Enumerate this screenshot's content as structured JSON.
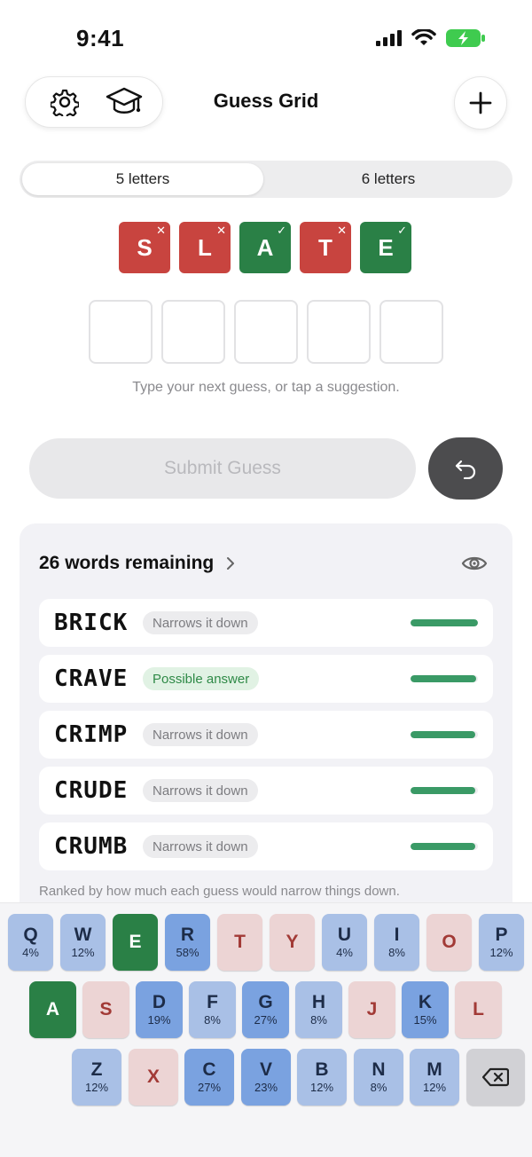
{
  "status_bar": {
    "time": "9:41"
  },
  "header": {
    "title": "Guess Grid"
  },
  "mode": {
    "options": [
      "5 letters",
      "6 letters"
    ],
    "selected": "5 letters"
  },
  "previous_guess": [
    {
      "letter": "S",
      "mark": "✕",
      "state": "absent"
    },
    {
      "letter": "L",
      "mark": "✕",
      "state": "absent"
    },
    {
      "letter": "A",
      "mark": "✓",
      "state": "correct"
    },
    {
      "letter": "T",
      "mark": "✕",
      "state": "absent"
    },
    {
      "letter": "E",
      "mark": "✓",
      "state": "correct"
    }
  ],
  "current_guess": [
    "",
    "",
    "",
    "",
    ""
  ],
  "hint": "Type your next guess, or tap a suggestion.",
  "actions": {
    "submit_label": "Submit Guess"
  },
  "remaining": {
    "title": "26 words remaining",
    "suggestions": [
      {
        "word": "BRICK",
        "badge": "Narrows it down",
        "badge_type": "narrow",
        "score": 1.0
      },
      {
        "word": "CRAVE",
        "badge": "Possible answer",
        "badge_type": "possible",
        "score": 0.97
      },
      {
        "word": "CRIMP",
        "badge": "Narrows it down",
        "badge_type": "narrow",
        "score": 0.96
      },
      {
        "word": "CRUDE",
        "badge": "Narrows it down",
        "badge_type": "narrow",
        "score": 0.96
      },
      {
        "word": "CRUMB",
        "badge": "Narrows it down",
        "badge_type": "narrow",
        "score": 0.96
      }
    ],
    "footnote": "Ranked by how much each guess would narrow things down."
  },
  "keyboard": {
    "rows": [
      [
        {
          "letter": "Q",
          "pct": "4%",
          "state": "light"
        },
        {
          "letter": "W",
          "pct": "12%",
          "state": "light"
        },
        {
          "letter": "E",
          "pct": "",
          "state": "correct"
        },
        {
          "letter": "R",
          "pct": "58%",
          "state": "dark"
        },
        {
          "letter": "T",
          "pct": "",
          "state": "absent"
        },
        {
          "letter": "Y",
          "pct": "",
          "state": "absent"
        },
        {
          "letter": "U",
          "pct": "4%",
          "state": "light"
        },
        {
          "letter": "I",
          "pct": "8%",
          "state": "light"
        },
        {
          "letter": "O",
          "pct": "",
          "state": "absent"
        },
        {
          "letter": "P",
          "pct": "12%",
          "state": "light"
        }
      ],
      [
        {
          "letter": "A",
          "pct": "",
          "state": "correct"
        },
        {
          "letter": "S",
          "pct": "",
          "state": "absent"
        },
        {
          "letter": "D",
          "pct": "19%",
          "state": "dark"
        },
        {
          "letter": "F",
          "pct": "8%",
          "state": "light"
        },
        {
          "letter": "G",
          "pct": "27%",
          "state": "dark"
        },
        {
          "letter": "H",
          "pct": "8%",
          "state": "light"
        },
        {
          "letter": "J",
          "pct": "",
          "state": "absent"
        },
        {
          "letter": "K",
          "pct": "15%",
          "state": "dark"
        },
        {
          "letter": "L",
          "pct": "",
          "state": "absent"
        }
      ],
      [
        {
          "letter": "Z",
          "pct": "12%",
          "state": "light"
        },
        {
          "letter": "X",
          "pct": "",
          "state": "absent"
        },
        {
          "letter": "C",
          "pct": "27%",
          "state": "dark"
        },
        {
          "letter": "V",
          "pct": "23%",
          "state": "dark"
        },
        {
          "letter": "B",
          "pct": "12%",
          "state": "light"
        },
        {
          "letter": "N",
          "pct": "8%",
          "state": "light"
        },
        {
          "letter": "M",
          "pct": "12%",
          "state": "light"
        }
      ]
    ]
  },
  "colors": {
    "absent": "#c8443f",
    "correct": "#2a8046",
    "key_dark": "#7aa2e0",
    "key_light": "#a9c0e6",
    "key_absent": "#ecd4d4"
  },
  "icons": [
    "gear-icon",
    "graduation-cap-icon",
    "plus-icon",
    "undo-icon",
    "eye-icon",
    "chevron-right-icon",
    "backspace-icon"
  ]
}
